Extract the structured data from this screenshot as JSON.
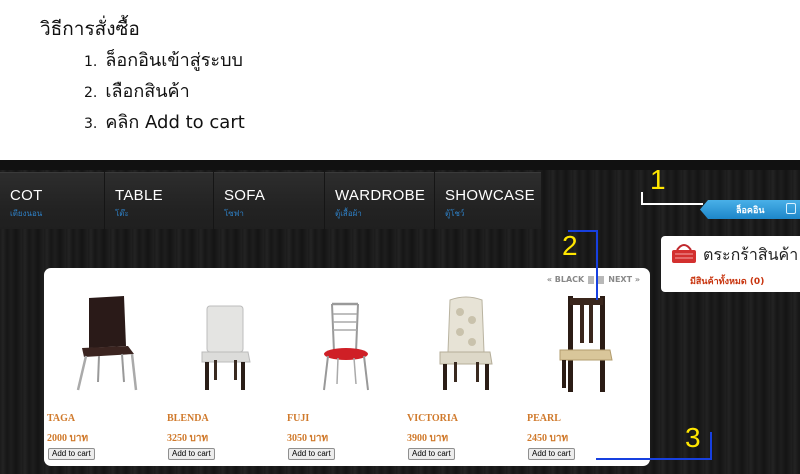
{
  "instructions": {
    "title": "วิธีการสั่งซื้อ",
    "steps": [
      {
        "num": "1.",
        "text": "ล็อกอินเข้าสู่ระบบ"
      },
      {
        "num": "2.",
        "text": "เลือกสินค้า"
      },
      {
        "num": "3.",
        "text": "คลิก Add to cart"
      }
    ]
  },
  "nav": [
    {
      "title": "COT",
      "sub": "เตียงนอน"
    },
    {
      "title": "TABLE",
      "sub": "โต๊ะ"
    },
    {
      "title": "SOFA",
      "sub": "โซฟา"
    },
    {
      "title": "WARDROBE",
      "sub": "ตู้เสื้อผ้า"
    },
    {
      "title": "SHOWCASE",
      "sub": "ตู้โชว์"
    }
  ],
  "login": {
    "label": "ล็อคอิน"
  },
  "cart": {
    "label": "ตระกร้าสินค้า",
    "count": "มีสินค้าทั้งหมด (0)"
  },
  "pager": {
    "prev": "« BLACK",
    "next": "NEXT »"
  },
  "products": [
    {
      "name": "TAGA",
      "price": "2000 บาท",
      "button": "Add to cart"
    },
    {
      "name": "BLENDA",
      "price": "3250 บาท",
      "button": "Add to cart"
    },
    {
      "name": "FUJI",
      "price": "3050 บาท",
      "button": "Add to cart"
    },
    {
      "name": "VICTORIA",
      "price": "3900 บาท",
      "button": "Add to cart"
    },
    {
      "name": "PEARL",
      "price": "2450 บาท",
      "button": "Add to cart"
    }
  ],
  "annotations": {
    "a1": "1",
    "a2": "2",
    "a3": "3"
  },
  "colors": {
    "accent_blue": "#1d86c9",
    "price_orange": "#d07a2c",
    "annotation_yellow": "#ffe600"
  }
}
